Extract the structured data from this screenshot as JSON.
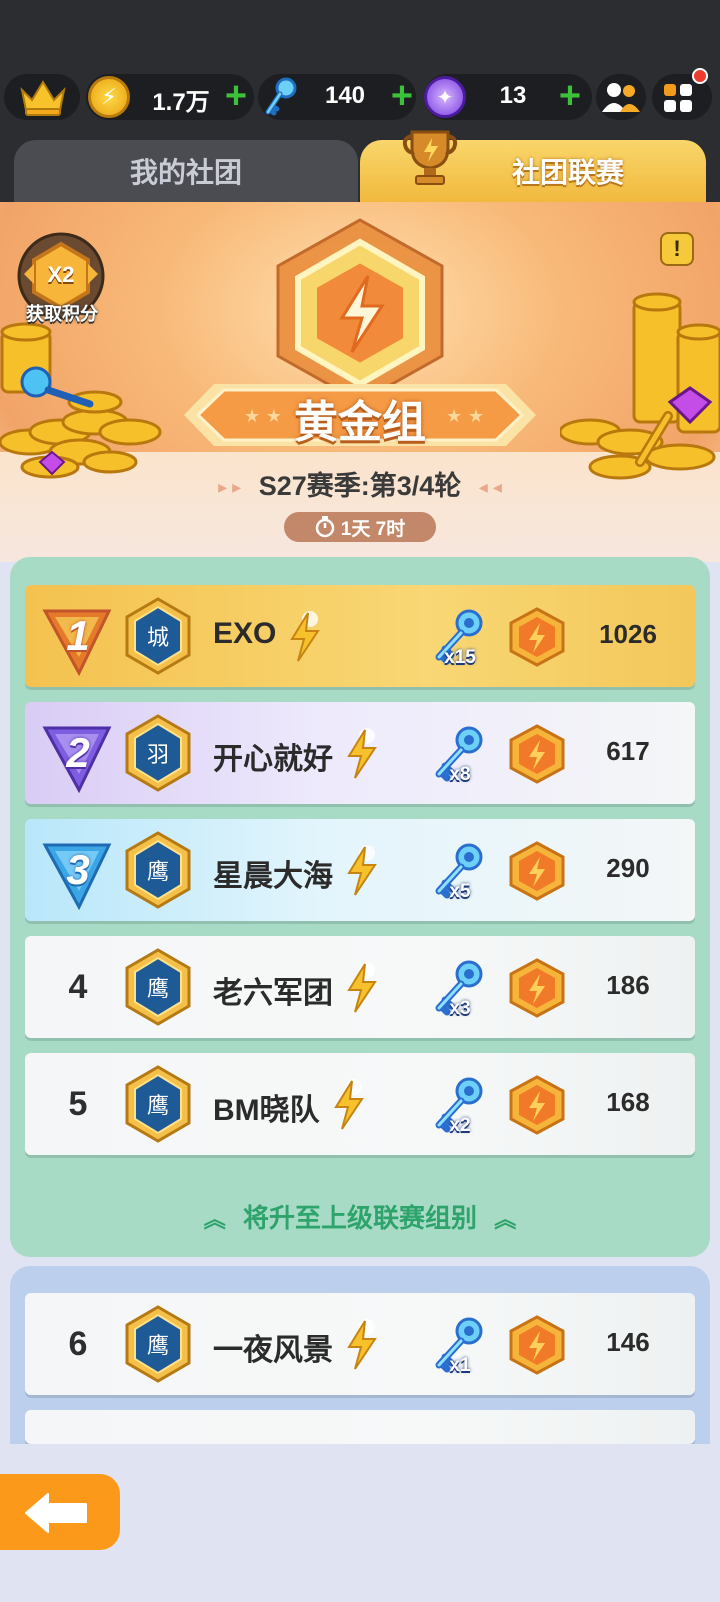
{
  "resources": {
    "crown_icon": "crown-icon",
    "coins": "1.7万",
    "keys": "140",
    "gems": "13",
    "plus": "+"
  },
  "tabs": {
    "mine": "我的社团",
    "league": "社团联赛"
  },
  "banner": {
    "bonus_multiplier": "X2",
    "bonus_label": "获取积分",
    "info": "!",
    "group": "黄金组",
    "season": "S27赛季:第3/4轮",
    "timer": "1天 7时",
    "arrow_left": "▸ ▸",
    "arrow_right": "◂ ◂"
  },
  "rankings": [
    {
      "rank": "1",
      "name": "EXO",
      "keys": "x15",
      "score": "1026"
    },
    {
      "rank": "2",
      "name": "开心就好",
      "keys": "x8",
      "score": "617"
    },
    {
      "rank": "3",
      "name": "星晨大海",
      "keys": "x5",
      "score": "290"
    },
    {
      "rank": "4",
      "name": "老六军团",
      "keys": "x3",
      "score": "186"
    },
    {
      "rank": "5",
      "name": "BM晓队",
      "keys": "x2",
      "score": "168"
    },
    {
      "rank": "6",
      "name": "一夜风景",
      "keys": "x1",
      "score": "146"
    }
  ],
  "promote_text": "将升至上级联赛组别",
  "colors": {
    "gold": "#f4c24f",
    "promote_green": "#2ea36c",
    "tab_league": "#f1b93d",
    "back_button": "#fb9a1a"
  }
}
